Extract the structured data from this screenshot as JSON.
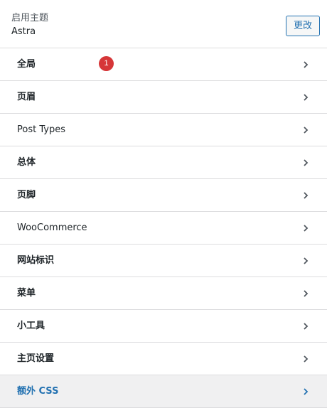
{
  "theme": {
    "label": "启用主题",
    "name": "Astra",
    "change_button": "更改"
  },
  "badge": {
    "count": "1",
    "color": "#d63638"
  },
  "menu": {
    "items": [
      {
        "label": "全局"
      },
      {
        "label": "页眉"
      },
      {
        "label": "Post Types"
      },
      {
        "label": "总体"
      },
      {
        "label": "页脚"
      },
      {
        "label": "WooCommerce"
      },
      {
        "label": "网站标识"
      },
      {
        "label": "菜单"
      },
      {
        "label": "小工具"
      },
      {
        "label": "主页设置"
      },
      {
        "label": "额外 CSS"
      }
    ],
    "icon": "chevron-right-icon"
  },
  "colors": {
    "accent": "#2271b1",
    "border": "#dcdcde",
    "background": "#f0f0f1"
  }
}
